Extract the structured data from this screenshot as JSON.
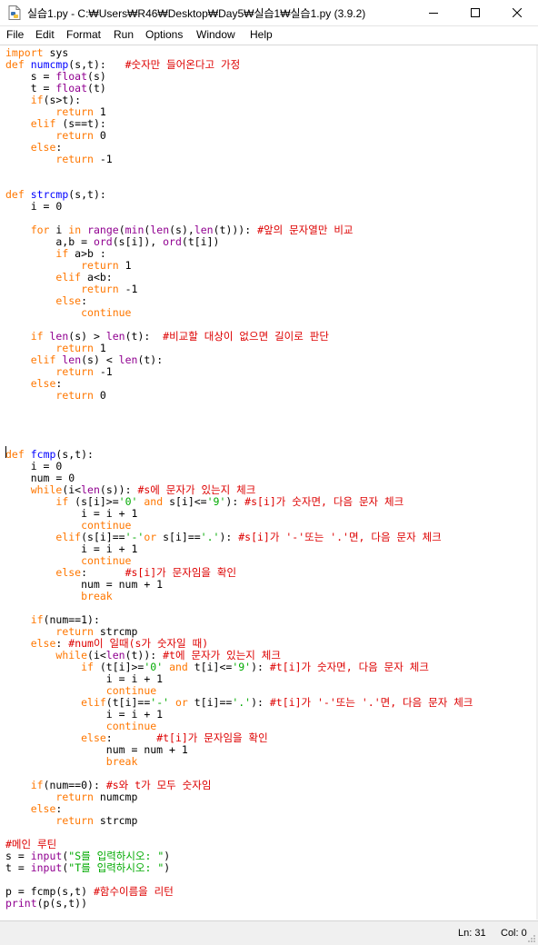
{
  "window": {
    "title": "실습1.py - C:₩Users₩R46₩Desktop₩Day5₩실습1₩실습1.py (3.9.2)"
  },
  "menu": {
    "items": [
      "File",
      "Edit",
      "Format",
      "Run",
      "Options",
      "Window",
      "Help"
    ]
  },
  "editor": {
    "lines": [
      "import sys",
      "def numcmp(s,t):   #숫자만 들어온다고 가정",
      "    s = float(s)",
      "    t = float(t)",
      "    if(s>t):",
      "        return 1",
      "    elif (s==t):",
      "        return 0",
      "    else:",
      "        return -1",
      "",
      "",
      "def strcmp(s,t):",
      "    i = 0",
      "",
      "    for i in range(min(len(s),len(t))): #앞의 문자열만 비교",
      "        a,b = ord(s[i]), ord(t[i])",
      "        if a>b :",
      "            return 1",
      "        elif a<b:",
      "            return -1",
      "        else:",
      "            continue",
      "",
      "    if len(s) > len(t):  #비교할 대상이 없으면 길이로 판단",
      "        return 1",
      "    elif len(s) < len(t):",
      "        return -1",
      "    else:",
      "        return 0",
      "",
      "",
      "",
      "",
      "def fcmp(s,t):",
      "    i = 0",
      "    num = 0",
      "    while(i<len(s)): #s에 문자가 있는지 체크",
      "        if (s[i]>='0' and s[i]<='9'): #s[i]가 숫자면, 다음 문자 체크",
      "            i = i + 1",
      "            continue",
      "        elif(s[i]=='-'or s[i]=='.'): #s[i]가 '-'또는 '.'면, 다음 문자 체크",
      "            i = i + 1",
      "            continue",
      "        else:      #s[i]가 문자임을 확인",
      "            num = num + 1",
      "            break",
      "",
      "    if(num==1):",
      "        return strcmp",
      "    else: #num이 일때(s가 숫자일 때)",
      "        while(i<len(t)): #t에 문자가 있는지 체크",
      "            if (t[i]>='0' and t[i]<='9'): #t[i]가 숫자면, 다음 문자 체크",
      "                i = i + 1",
      "                continue",
      "            elif(t[i]=='-' or t[i]=='.'): #t[i]가 '-'또는 '.'면, 다음 문자 체크",
      "                i = i + 1",
      "                continue",
      "            else:       #t[i]가 문자임을 확인",
      "                num = num + 1",
      "                break",
      "",
      "    if(num==0): #s와 t가 모두 숫자임",
      "        return numcmp",
      "    else:",
      "        return strcmp",
      "",
      "#메인 루틴",
      "s = input(\"S를 입력하시오: \")",
      "t = input(\"T를 입력하시오: \")",
      "",
      "p = fcmp(s,t) #함수이름을 리턴",
      "print(p(s,t))"
    ]
  },
  "status": {
    "line": "Ln: 31",
    "col": "Col: 0"
  },
  "colors": {
    "keyword": "#ff7700",
    "builtin": "#900090",
    "string": "#00aa00",
    "comment": "#dd0000",
    "definition": "#0000ff"
  },
  "icons": {
    "app": "python-file-icon",
    "minimize": "minimize-icon",
    "maximize": "maximize-icon",
    "close": "close-icon"
  }
}
